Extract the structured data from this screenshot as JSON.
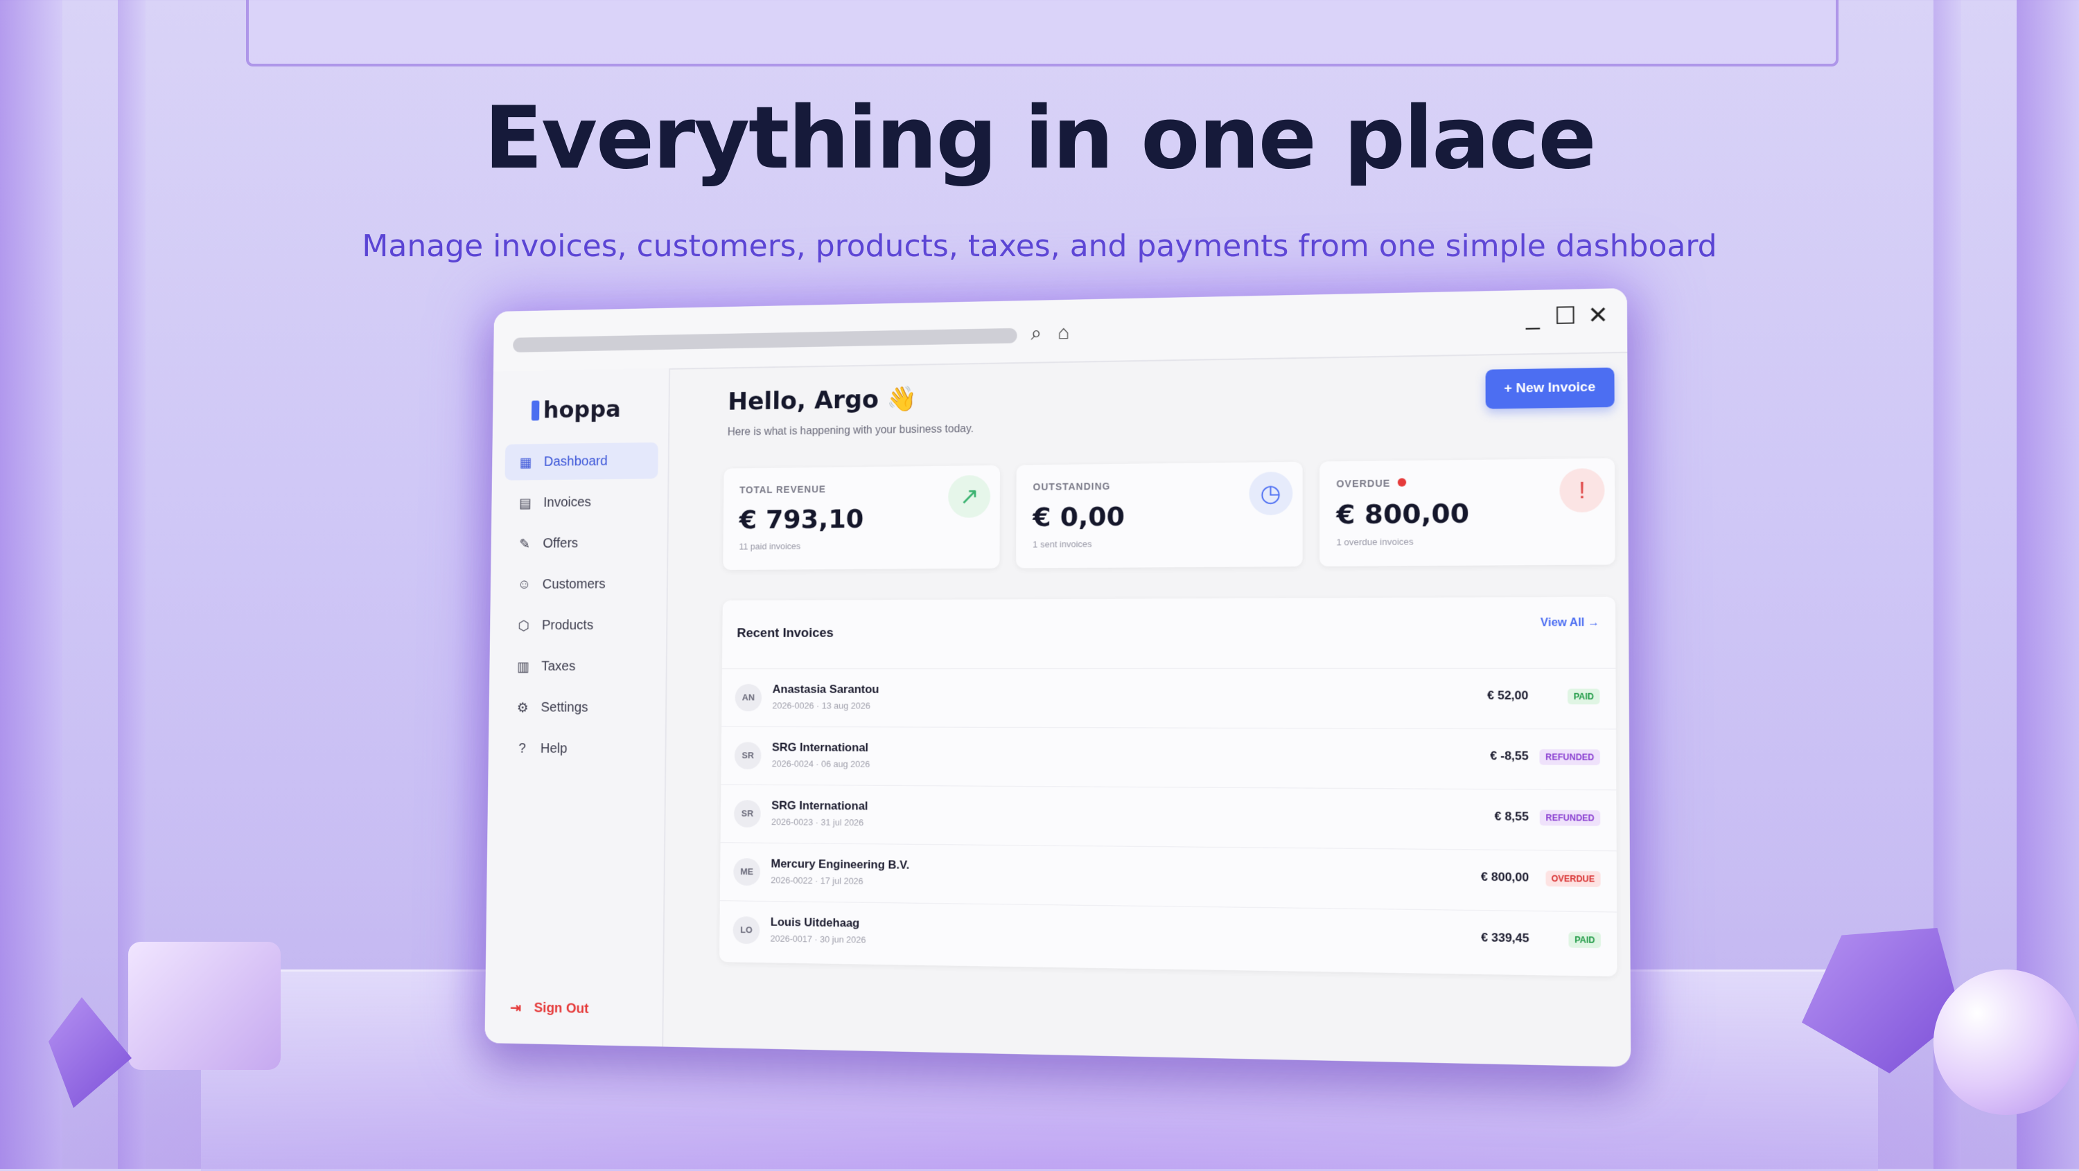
{
  "hero": {
    "title": "Everything in one place",
    "subtitle": "Manage invoices, customers, products, taxes, and payments from one simple dashboard"
  },
  "window": {
    "controls": {
      "minimize": "_",
      "maximize": "☐",
      "close": "✕"
    },
    "search_icon": "search-icon",
    "home_icon": "home-icon"
  },
  "app": {
    "logo": "hoppa",
    "sidebar": {
      "items": [
        {
          "label": "Dashboard",
          "icon": "grid-icon",
          "glyph": "▦",
          "active": true
        },
        {
          "label": "Invoices",
          "icon": "document-icon",
          "glyph": "▤"
        },
        {
          "label": "Offers",
          "icon": "edit-document-icon",
          "glyph": "✎"
        },
        {
          "label": "Customers",
          "icon": "users-icon",
          "glyph": "☺"
        },
        {
          "label": "Products",
          "icon": "box-icon",
          "glyph": "⬡"
        },
        {
          "label": "Taxes",
          "icon": "receipt-icon",
          "glyph": "▥"
        },
        {
          "label": "Settings",
          "icon": "gear-icon",
          "glyph": "⚙"
        },
        {
          "label": "Help",
          "icon": "help-icon",
          "glyph": "?"
        }
      ],
      "sign_out": "Sign Out"
    },
    "greeting": "Hello, Argo 👋",
    "greeting_sub": "Here is what is happening with your business today.",
    "new_invoice": "+  New Invoice",
    "stats": [
      {
        "label": "TOTAL REVENUE",
        "value": "€ 793,10",
        "note": "11 paid invoices",
        "icon": "trending-up-icon",
        "icon_color": "#3cb371",
        "icon_bg": "#e6f6ea",
        "glyph": "↗"
      },
      {
        "label": "OUTSTANDING",
        "value": "€ 0,00",
        "note": "1 sent invoices",
        "icon": "clock-icon",
        "icon_color": "#4c6ef2",
        "icon_bg": "#e6ebfb",
        "glyph": "◷"
      },
      {
        "label": "OVERDUE",
        "value": "€ 800,00",
        "note": "1 overdue invoices",
        "icon": "alert-icon",
        "icon_color": "#e04848",
        "icon_bg": "#fbe4e4",
        "glyph": "!"
      }
    ],
    "recent": {
      "title": "Recent Invoices",
      "view_all": "View All →",
      "rows": [
        {
          "initials": "AN",
          "customer": "Anastasia Sarantou",
          "meta": "2026-0026 · 13 aug 2026",
          "amount": "€ 52,00",
          "status": "PAID",
          "status_kind": "paid"
        },
        {
          "initials": "SR",
          "customer": "SRG International",
          "meta": "2026-0024 · 06 aug 2026",
          "amount": "€ -8,55",
          "status": "REFUNDED",
          "status_kind": "refunded"
        },
        {
          "initials": "SR",
          "customer": "SRG International",
          "meta": "2026-0023 · 31 jul 2026",
          "amount": "€ 8,55",
          "status": "REFUNDED",
          "status_kind": "refunded"
        },
        {
          "initials": "ME",
          "customer": "Mercury Engineering B.V.",
          "meta": "2026-0022 · 17 jul 2026",
          "amount": "€ 800,00",
          "status": "OVERDUE",
          "status_kind": "overdue"
        },
        {
          "initials": "LO",
          "customer": "Louis Uitdehaag",
          "meta": "2026-0017 · 30 jun 2026",
          "amount": "€ 339,45",
          "status": "PAID",
          "status_kind": "paid"
        }
      ]
    }
  }
}
